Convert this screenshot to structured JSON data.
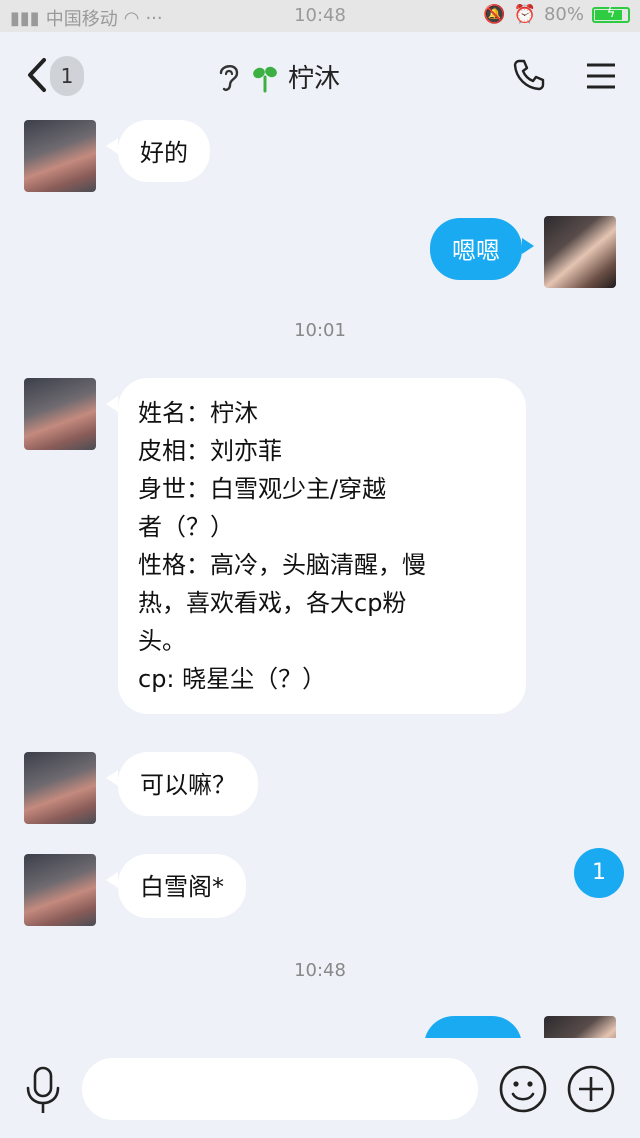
{
  "status_bar": {
    "carrier": "中国移动",
    "time": "10:48",
    "battery": "80%",
    "battery_level": 0.8
  },
  "header": {
    "back_badge": "1",
    "title": "柠沐",
    "icons": [
      "back-arrow-icon",
      "ear-icon",
      "sprout-icon",
      "phone-icon",
      "menu-icon"
    ]
  },
  "messages": [
    {
      "sender": "them",
      "text": "好的"
    },
    {
      "sender": "me",
      "text": "嗯嗯"
    },
    {
      "type": "timestamp",
      "text": "10:01"
    },
    {
      "sender": "them",
      "lines": [
        "姓名：柠沐",
        "皮相：刘亦菲",
        "身世：白雪观少主/穿越",
        "者（？）",
        "性格：高冷，头脑清醒，慢",
        "热，喜欢看戏，各大cp粉",
        "头。",
        "cp: 晓星尘（？）"
      ]
    },
    {
      "sender": "them",
      "text": "可以嘛？"
    },
    {
      "sender": "them",
      "text": "白雪阁*"
    },
    {
      "type": "timestamp",
      "text": "10:48"
    },
    {
      "sender": "me",
      "text": ""
    }
  ],
  "unread_float": "1",
  "input_bar": {
    "placeholder": "",
    "icons": [
      "mic-icon",
      "emoji-icon",
      "plus-icon"
    ]
  },
  "colors": {
    "background": "#eef1f7",
    "my_bubble": "#19aaf2",
    "their_bubble": "#ffffff",
    "battery": "#2ecc40"
  }
}
